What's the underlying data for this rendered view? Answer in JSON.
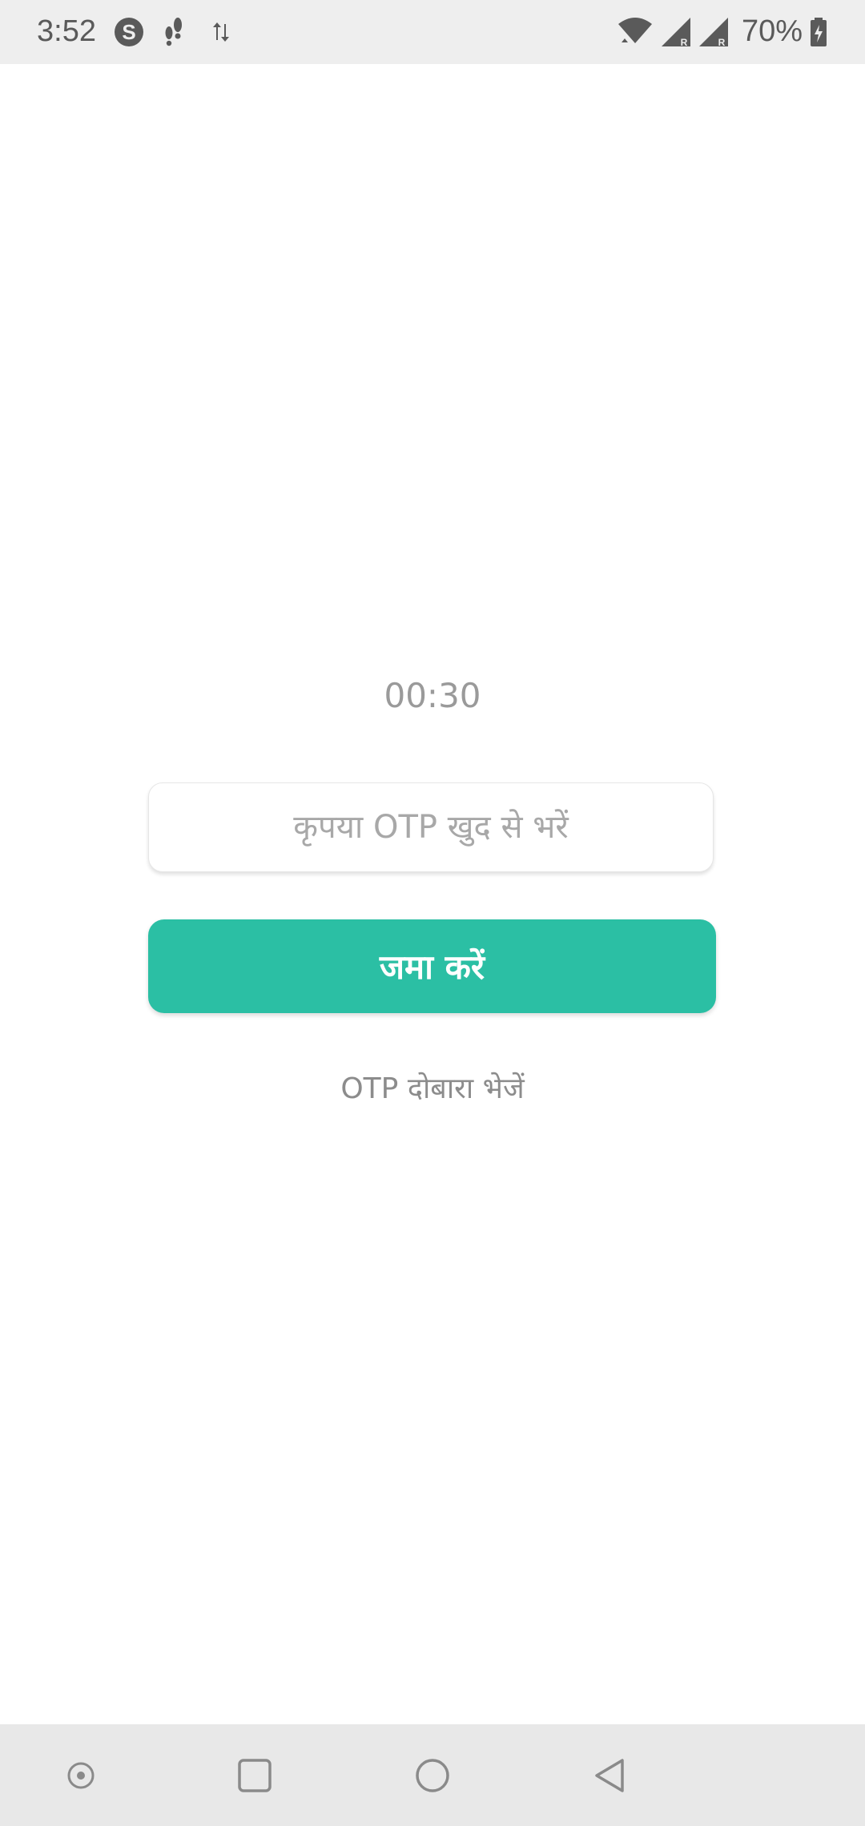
{
  "status_bar": {
    "time": "3:52",
    "battery": "70%",
    "icons": [
      "skype-icon",
      "footsteps-icon",
      "data-transfer-icon",
      "wifi-icon",
      "signal-r-icon",
      "signal-r-icon",
      "battery-charging-icon"
    ]
  },
  "otp": {
    "timer": "00:30",
    "placeholder": "कृपया OTP खुद से भरें",
    "value": "",
    "submit_label": "जमा करें",
    "resend_label": "OTP दोबारा भेजें"
  },
  "nav_bar": {
    "buttons": [
      "assist-icon",
      "recents-icon",
      "home-icon",
      "back-icon"
    ]
  },
  "colors": {
    "accent": "#2bbfa4",
    "status_bar_bg": "#eeeeee",
    "nav_bar_bg": "#e8e8e8"
  }
}
